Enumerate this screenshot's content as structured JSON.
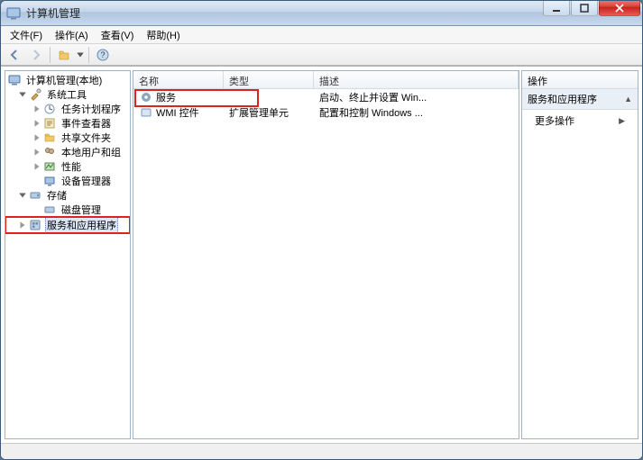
{
  "window": {
    "title": "计算机管理"
  },
  "menus": {
    "file": "文件(F)",
    "action": "操作(A)",
    "view": "查看(V)",
    "help": "帮助(H)"
  },
  "tree": {
    "root": "计算机管理(本地)",
    "system_tools": "系统工具",
    "task_scheduler": "任务计划程序",
    "event_viewer": "事件查看器",
    "shared_folders": "共享文件夹",
    "local_users": "本地用户和组",
    "performance": "性能",
    "device_manager": "设备管理器",
    "storage": "存储",
    "disk_management": "磁盘管理",
    "services_apps": "服务和应用程序"
  },
  "list": {
    "columns": {
      "name": "名称",
      "type": "类型",
      "desc": "描述"
    },
    "rows": [
      {
        "name": "服务",
        "type": "",
        "desc": "启动、终止并设置 Win..."
      },
      {
        "name": "WMI 控件",
        "type": "扩展管理单元",
        "desc": "配置和控制 Windows ..."
      }
    ]
  },
  "actions": {
    "header": "操作",
    "section_title": "服务和应用程序",
    "more_actions": "更多操作"
  }
}
